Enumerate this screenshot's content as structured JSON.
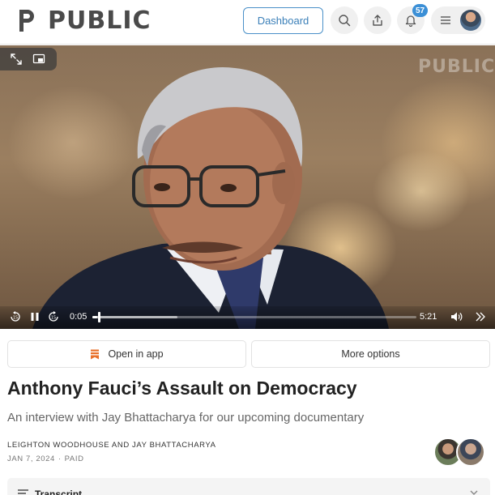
{
  "header": {
    "logo_text": "PUBLIC",
    "dashboard_label": "Dashboard",
    "notification_count": "57"
  },
  "video": {
    "watermark": "PUBLIC",
    "current_time": "0:05",
    "duration": "5:21",
    "progress_fraction": 0.016
  },
  "actions": {
    "open_in_app": "Open in app",
    "more_options": "More options"
  },
  "post": {
    "title": "Anthony Fauci’s Assault on Democracy",
    "subtitle": "An interview with Jay Bhattacharya for our upcoming documentary",
    "authors": "LEIGHTON WOODHOUSE AND JAY BHATTACHARYA",
    "date": "JAN 7, 2024",
    "access": "PAID"
  },
  "transcript": {
    "label": "Transcript"
  },
  "colors": {
    "accent": "#3b8fd6",
    "app_icon": "#e8702a"
  },
  "icons": [
    "logo-p-icon",
    "search-icon",
    "share-icon",
    "bell-icon",
    "menu-icon",
    "expand-icon",
    "picture-in-picture-icon",
    "rewind-15-icon",
    "pause-icon",
    "forward-15-icon",
    "volume-icon",
    "fast-forward-icon",
    "bookmark-icon",
    "transcript-list-icon",
    "chevron-down-icon"
  ]
}
